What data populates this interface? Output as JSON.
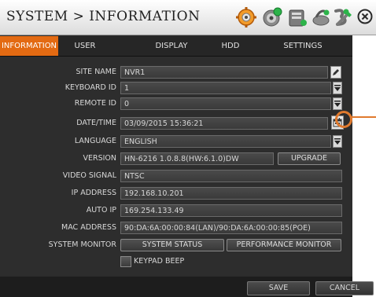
{
  "window": {
    "title": "SYSTEM > INFORMATION"
  },
  "toolbar_icons": [
    "camera-settings-icon",
    "record-icon",
    "storage-icon",
    "network-icon",
    "event-icon",
    "device-icon",
    "close-icon"
  ],
  "tabs": [
    {
      "label": "INFORMATION",
      "active": true
    },
    {
      "label": "USER"
    },
    {
      "label": "DISPLAY"
    },
    {
      "label": "HDD"
    },
    {
      "label": "SETTINGS"
    }
  ],
  "form": {
    "site_name": {
      "label": "SITE NAME",
      "value": "NVR1"
    },
    "keyboard_id": {
      "label": "KEYBOARD ID",
      "value": "1"
    },
    "remote_id": {
      "label": "REMOTE ID",
      "value": "0"
    },
    "date_time": {
      "label": "DATE/TIME",
      "value": "03/09/2015 15:36:21"
    },
    "language": {
      "label": "LANGUAGE",
      "value": "ENGLISH"
    },
    "version": {
      "label": "VERSION",
      "value": "HN-6216 1.0.8.8(HW:6.1.0)DW",
      "button": "UPGRADE"
    },
    "video_signal": {
      "label": "VIDEO SIGNAL",
      "value": "NTSC"
    },
    "ip_address": {
      "label": "IP ADDRESS",
      "value": "192.168.10.201"
    },
    "auto_ip": {
      "label": "AUTO IP",
      "value": "169.254.133.49"
    },
    "mac_address": {
      "label": "MAC ADDRESS",
      "value": "90:DA:6A:00:00:84(LAN)/90:DA:6A:00:00:85(POE)"
    },
    "system_monitor": {
      "label": "SYSTEM MONITOR",
      "status_button": "SYSTEM STATUS",
      "performance_button": "PERFORMANCE MONITOR"
    },
    "keypad_beep": {
      "label": "KEYPAD BEEP",
      "checked": false
    }
  },
  "footer": {
    "save": "SAVE",
    "cancel": "CANCEL"
  },
  "colors": {
    "accent": "#e36a12",
    "callout": "#e07a2e",
    "panel": "#2d2d2d"
  }
}
